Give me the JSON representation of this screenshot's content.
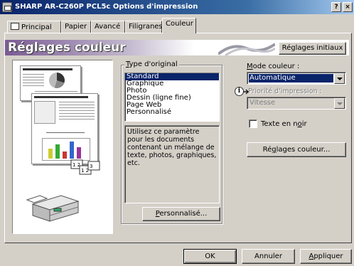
{
  "window": {
    "title": "SHARP AR-C260P PCL5c Options d'impression",
    "help_button": "?",
    "close_button": "×"
  },
  "tabs": [
    {
      "label": "Principal"
    },
    {
      "label": "Papier"
    },
    {
      "label": "Avancé"
    },
    {
      "label": "Filigranes"
    },
    {
      "label": "Couleur"
    }
  ],
  "banner": {
    "heading": "Réglages couleur",
    "reset_button": "Réglages initiaux"
  },
  "original_type": {
    "label_prefix": "T",
    "label_rest": "ype d'original",
    "items": [
      "Standard",
      "Graphique",
      "Photo",
      "Dessin (ligne fine)",
      "Page Web",
      "Personnalisé"
    ],
    "selected_index": 0,
    "description": "Utilisez ce paramètre pour les documents contenant un mélange de texte, photos, graphiques, etc.",
    "custom_button_prefix": "P",
    "custom_button_rest": "ersonnalisé..."
  },
  "color_mode": {
    "label_prefix": "M",
    "label_rest": "ode couleur :",
    "value": "Automatique"
  },
  "print_priority": {
    "label": "Priorité d'impression :",
    "value": "Vitesse",
    "disabled": true
  },
  "black_text": {
    "label_pre": "Texte en n",
    "label_ul": "o",
    "label_post": "ir",
    "checked": false
  },
  "color_settings_button": {
    "prefix": "Ré",
    "ul": "g",
    "rest": "lages couleur..."
  },
  "footer": {
    "ok": "OK",
    "cancel": "Annuler",
    "apply_ul": "A",
    "apply_rest": "ppliquer"
  },
  "preview": {
    "page_heading": "The Effect of Interface Design",
    "chart_caption": "Communication Effects"
  }
}
